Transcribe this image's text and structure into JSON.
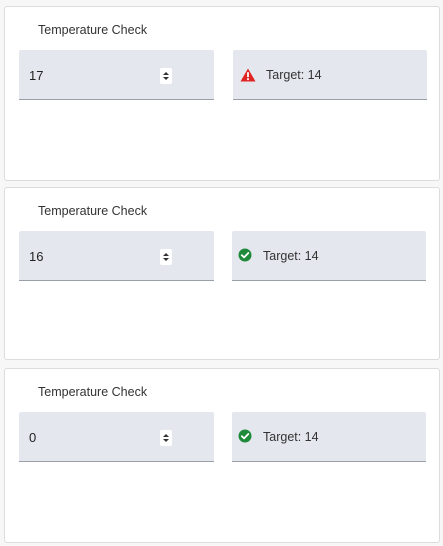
{
  "colors": {
    "card_bg": "#ffffff",
    "field_bg": "#e4e7ee",
    "warning": "#e02424",
    "success": "#1e8a3a"
  },
  "cards": [
    {
      "title": "Temperature Check",
      "value": "17",
      "status_icon": "warning-triangle-icon",
      "status_text": "Target: 14"
    },
    {
      "title": "Temperature Check",
      "value": "16",
      "status_icon": "check-circle-icon",
      "status_text": "Target: 14"
    },
    {
      "title": "Temperature Check",
      "value": "0",
      "status_icon": "check-circle-icon",
      "status_text": "Target: 14"
    }
  ]
}
